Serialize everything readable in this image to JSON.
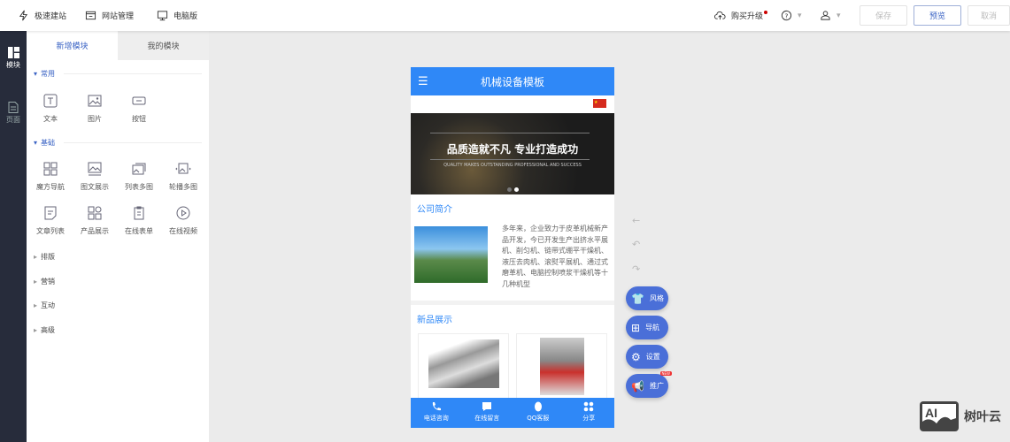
{
  "topbar": {
    "nav": [
      "极速建站",
      "网站管理",
      "电脑版"
    ],
    "upgrade": "购买升级",
    "save": "保存",
    "preview": "预览",
    "cancel": "取消"
  },
  "rail": {
    "items": [
      "模块",
      "页面"
    ]
  },
  "panel": {
    "tabs": [
      "新增模块",
      "我的模块"
    ],
    "sections": {
      "common": "常用",
      "basic": "基础",
      "collapsed": [
        "排版",
        "营销",
        "互动",
        "高级"
      ]
    },
    "common_modules": [
      "文本",
      "图片",
      "按钮"
    ],
    "basic_modules": [
      "魔方导航",
      "图文展示",
      "列表多图",
      "轮播多图",
      "文章列表",
      "产品展示",
      "在线表单",
      "在线视频"
    ]
  },
  "phone": {
    "title": "机械设备模板",
    "banner_title": "品质造就不凡 专业打造成功",
    "banner_sub": "QUALITY MAKES OUTSTANDING PROFESSIONAL AND SUCCESS",
    "about_title": "公司简介",
    "about_text": "多年来，企业致力于皮革机械新产品开发，今已开发生产出挤水平展机、削匀机、链带式绷平干燥机、液压去肉机、滚熨平展机、通过式磨革机、电脑控制喷浆干燥机等十几种机型",
    "products_title": "新品展示",
    "bottom": [
      "电话咨询",
      "在线留言",
      "QQ客服",
      "分享"
    ]
  },
  "fabs": [
    "风格",
    "导航",
    "设置",
    "推广"
  ],
  "fab_badge": "NEW",
  "watermark": "树叶云",
  "colors": {
    "accent": "#2f88f7",
    "fab": "#4a6fd8",
    "rail": "#272c3b"
  }
}
